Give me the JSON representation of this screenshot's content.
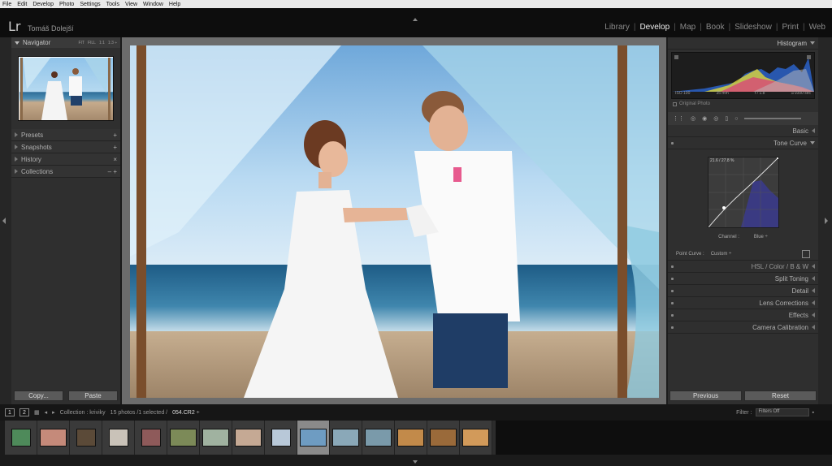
{
  "menu": [
    "File",
    "Edit",
    "Develop",
    "Photo",
    "Settings",
    "Tools",
    "View",
    "Window",
    "Help"
  ],
  "app": {
    "logo": "Lr",
    "user": "Tomáš Dolejší"
  },
  "modules": [
    {
      "label": "Library",
      "active": false
    },
    {
      "label": "Develop",
      "active": true
    },
    {
      "label": "Map",
      "active": false
    },
    {
      "label": "Book",
      "active": false
    },
    {
      "label": "Slideshow",
      "active": false
    },
    {
      "label": "Print",
      "active": false
    },
    {
      "label": "Web",
      "active": false
    }
  ],
  "left": {
    "navigator": {
      "title": "Navigator",
      "opts": [
        "FIT",
        "FILL",
        "1:1",
        "1:3 ÷"
      ]
    },
    "panels": [
      {
        "label": "Presets",
        "action": "+"
      },
      {
        "label": "Snapshots",
        "action": "+"
      },
      {
        "label": "History",
        "action": "×"
      },
      {
        "label": "Collections",
        "action": "– +"
      }
    ],
    "copy": "Copy...",
    "paste": "Paste"
  },
  "right": {
    "histogram": {
      "title": "Histogram",
      "iso": "ISO 100",
      "focal": "35 mm",
      "aperture": "f / 1.8",
      "shutter": "1/1000 sec",
      "original": "Original Photo"
    },
    "sections": [
      {
        "label": "Basic"
      },
      {
        "label": "Tone Curve"
      }
    ],
    "tonecurve": {
      "readout": "21.6 / 27.8 %",
      "channel_label": "Channel :",
      "channel": "Blue ÷",
      "pc_label": "Point Curve :",
      "pc": "Custom ÷"
    },
    "hsl": {
      "a": "HSL",
      "b": "Color",
      "c": "B & W"
    },
    "lower": [
      "Split Toning",
      "Detail",
      "Lens Corrections",
      "Effects",
      "Camera Calibration"
    ],
    "previous": "Previous",
    "reset": "Reset"
  },
  "filmbar": {
    "p1": "1",
    "p2": "2",
    "collection": "Collection : kriviky",
    "count": "15 photos /1 selected /",
    "file": "054.CR2 ÷",
    "filter": "Filter :",
    "filter_val": "Filters Off"
  },
  "colors": {
    "accent": "#ffffff",
    "bg": "#1b1b1b",
    "panel": "#2f2f2f"
  }
}
